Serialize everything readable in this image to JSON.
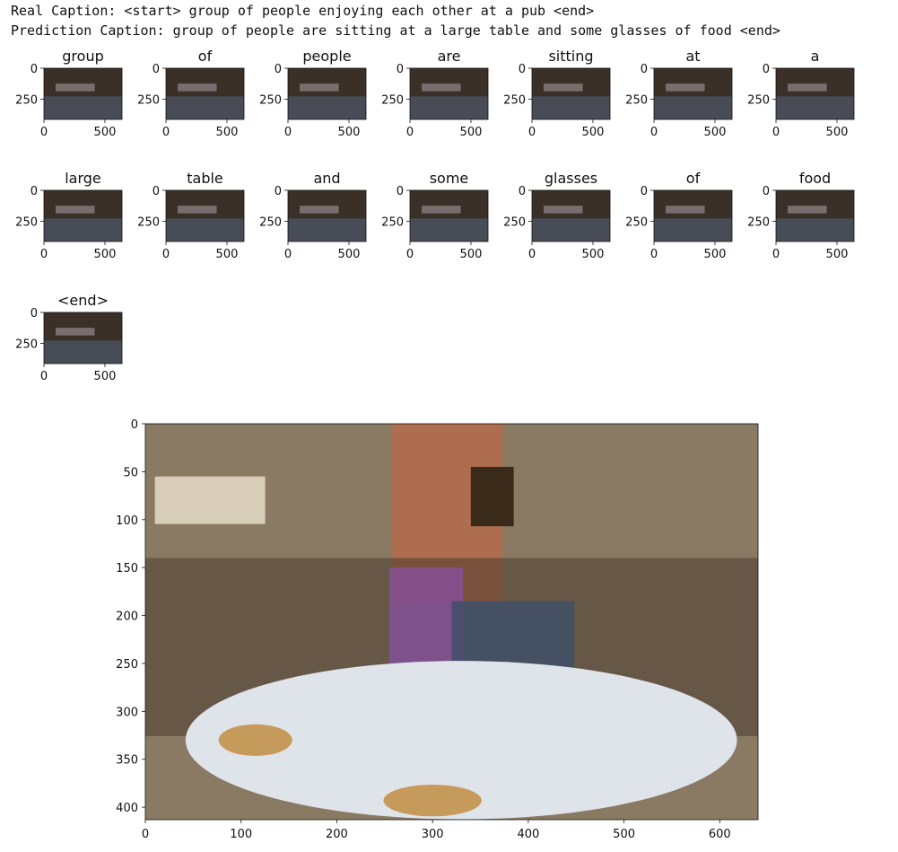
{
  "captions": {
    "real": "Real Caption: <start> group of people enjoying each other at a pub <end>",
    "prediction": "Prediction Caption: group of people are sitting at a large table and some glasses of food <end>"
  },
  "chart_data": [
    {
      "type": "image-grid",
      "titles": [
        "group",
        "of",
        "people",
        "are",
        "sitting",
        "at",
        "a",
        "large",
        "table",
        "and",
        "some",
        "glasses",
        "of",
        "food",
        "<end>"
      ],
      "y_ticks": [
        "0",
        "250"
      ],
      "x_ticks": [
        "0",
        "500"
      ],
      "x_tick_values": [
        0,
        500
      ],
      "y_tick_values": [
        0,
        250
      ]
    },
    {
      "type": "image",
      "x_ticks": [
        "0",
        "100",
        "200",
        "300",
        "400",
        "500",
        "600"
      ],
      "x_tick_values": [
        0,
        100,
        200,
        300,
        400,
        500,
        600
      ],
      "y_ticks": [
        "0",
        "50",
        "100",
        "150",
        "200",
        "250",
        "300",
        "350",
        "400"
      ],
      "y_tick_values": [
        0,
        50,
        100,
        150,
        200,
        250,
        300,
        350,
        400
      ],
      "xlim": [
        0,
        640
      ],
      "ylim": [
        413,
        0
      ]
    }
  ],
  "colors": {
    "axis": "#111111",
    "photo_dark": "#3a3028",
    "tablecloth": "#dfe4ea",
    "wall": "#8a7a64"
  }
}
